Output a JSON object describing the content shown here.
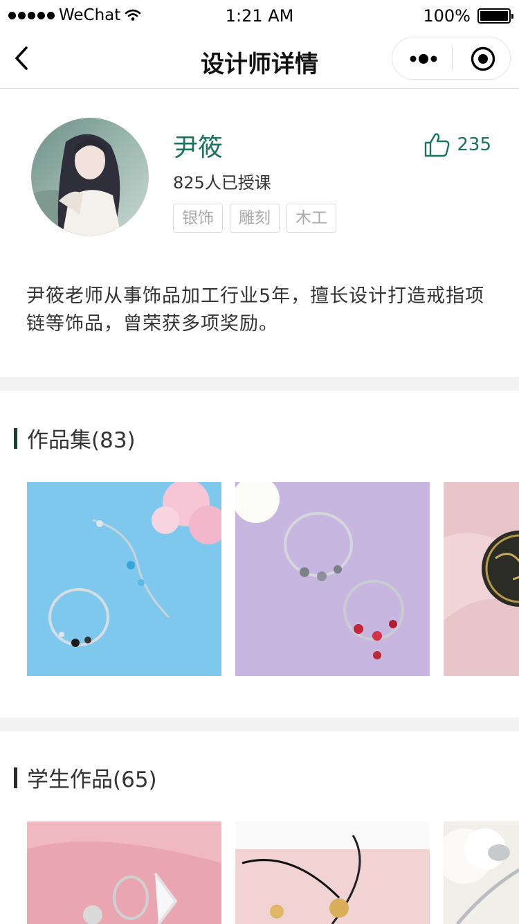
{
  "status_bar": {
    "carrier": "WeChat",
    "time": "1:21 AM",
    "battery": "100%"
  },
  "nav": {
    "title": "设计师详情",
    "back_icon": "chevron-left-icon",
    "more_icon": "more-dots-icon",
    "close_icon": "target-circle-icon"
  },
  "designer": {
    "name": "尹筱",
    "likes": "235",
    "taught": "825人已授课",
    "tags": [
      "银饰",
      "雕刻",
      "木工"
    ],
    "intro": "尹筱老师从事饰品加工行业5年，擅长设计打造戒指项链等饰品，曾荣获多项奖励。"
  },
  "portfolio": {
    "title": "作品集(83)"
  },
  "student_works": {
    "title": "学生作品(65)"
  },
  "colors": {
    "accent": "#19725f",
    "section_bar": "#1e3d34",
    "band": "#f2f2f2"
  }
}
